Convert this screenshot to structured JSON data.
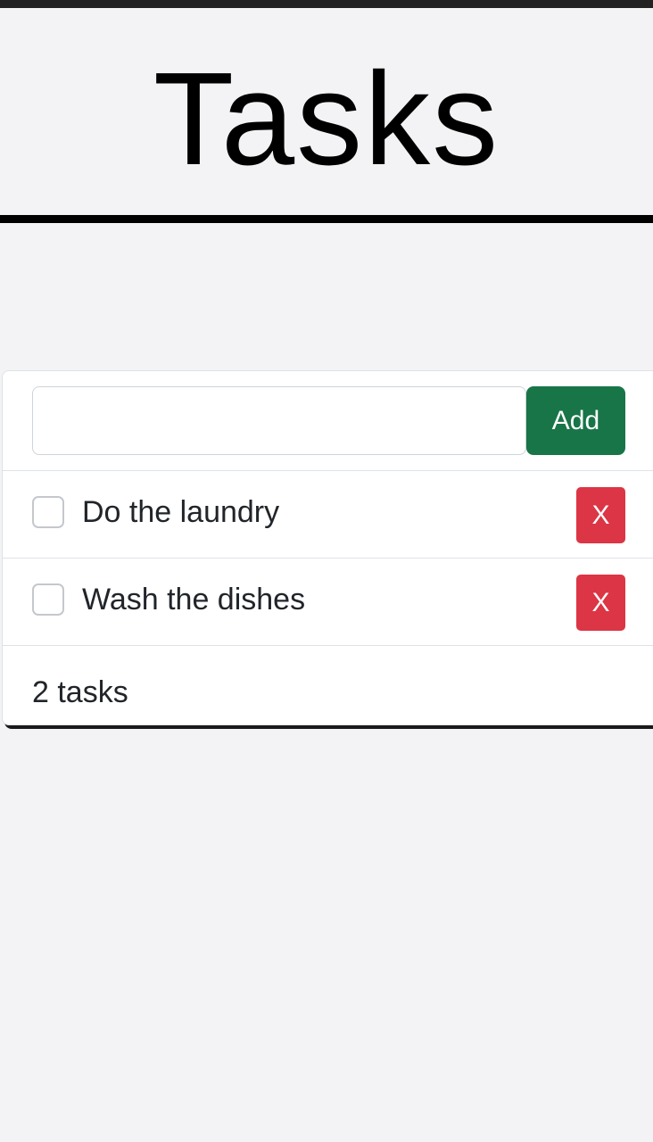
{
  "header": {
    "title": "Tasks"
  },
  "new_task": {
    "value": "",
    "placeholder": "",
    "add_label": "Add"
  },
  "tasks": [
    {
      "label": "Do the laundry",
      "done": false,
      "delete_label": "X"
    },
    {
      "label": "Wash the dishes",
      "done": false,
      "delete_label": "X"
    }
  ],
  "footer": {
    "count_text": "2 tasks"
  },
  "colors": {
    "add_button": "#187548",
    "delete_button": "#dc3545",
    "background": "#f3f3f5"
  }
}
